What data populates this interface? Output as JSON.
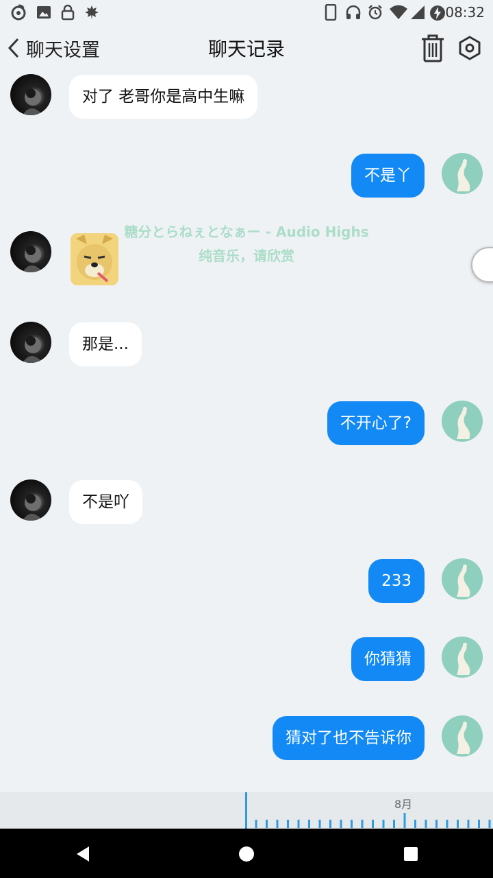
{
  "status_bar": {
    "time": "08:32",
    "left_icons": [
      "netease-music-icon",
      "image-icon",
      "lock-icon",
      "leaf-icon"
    ],
    "right_icons": [
      "phone-icon",
      "headphones-icon",
      "alarm-icon",
      "wifi-icon",
      "signal-icon",
      "battery-charging-icon"
    ]
  },
  "header": {
    "back_label": "聊天设置",
    "title": "聊天记录"
  },
  "lyrics": {
    "line1": "糖分とらねぇとなぁー - Audio Highs",
    "line2": "纯音乐，请欣赏"
  },
  "messages": [
    {
      "side": "left",
      "type": "text",
      "text": "对了 老哥你是高中生嘛"
    },
    {
      "side": "right",
      "type": "text",
      "text": "不是丫"
    },
    {
      "side": "left",
      "type": "sticker",
      "sticker": "doge-smoking-sticker"
    },
    {
      "side": "left",
      "type": "text",
      "text": "那是..."
    },
    {
      "side": "right",
      "type": "text",
      "text": "不开心了?"
    },
    {
      "side": "left",
      "type": "text",
      "text": "不是吖"
    },
    {
      "side": "right",
      "type": "text",
      "text": "233"
    },
    {
      "side": "right",
      "type": "text",
      "text": "你猜猜"
    },
    {
      "side": "right",
      "type": "text",
      "text": "猜对了也不告诉你"
    }
  ],
  "timeline": {
    "month_label": "8月"
  },
  "colors": {
    "background": "#eff2f5",
    "bubble_self": "#1289f5",
    "bubble_other": "#ffffff",
    "lyric_text": "#a8dcc6",
    "timeline_accent": "#2e9be0"
  }
}
